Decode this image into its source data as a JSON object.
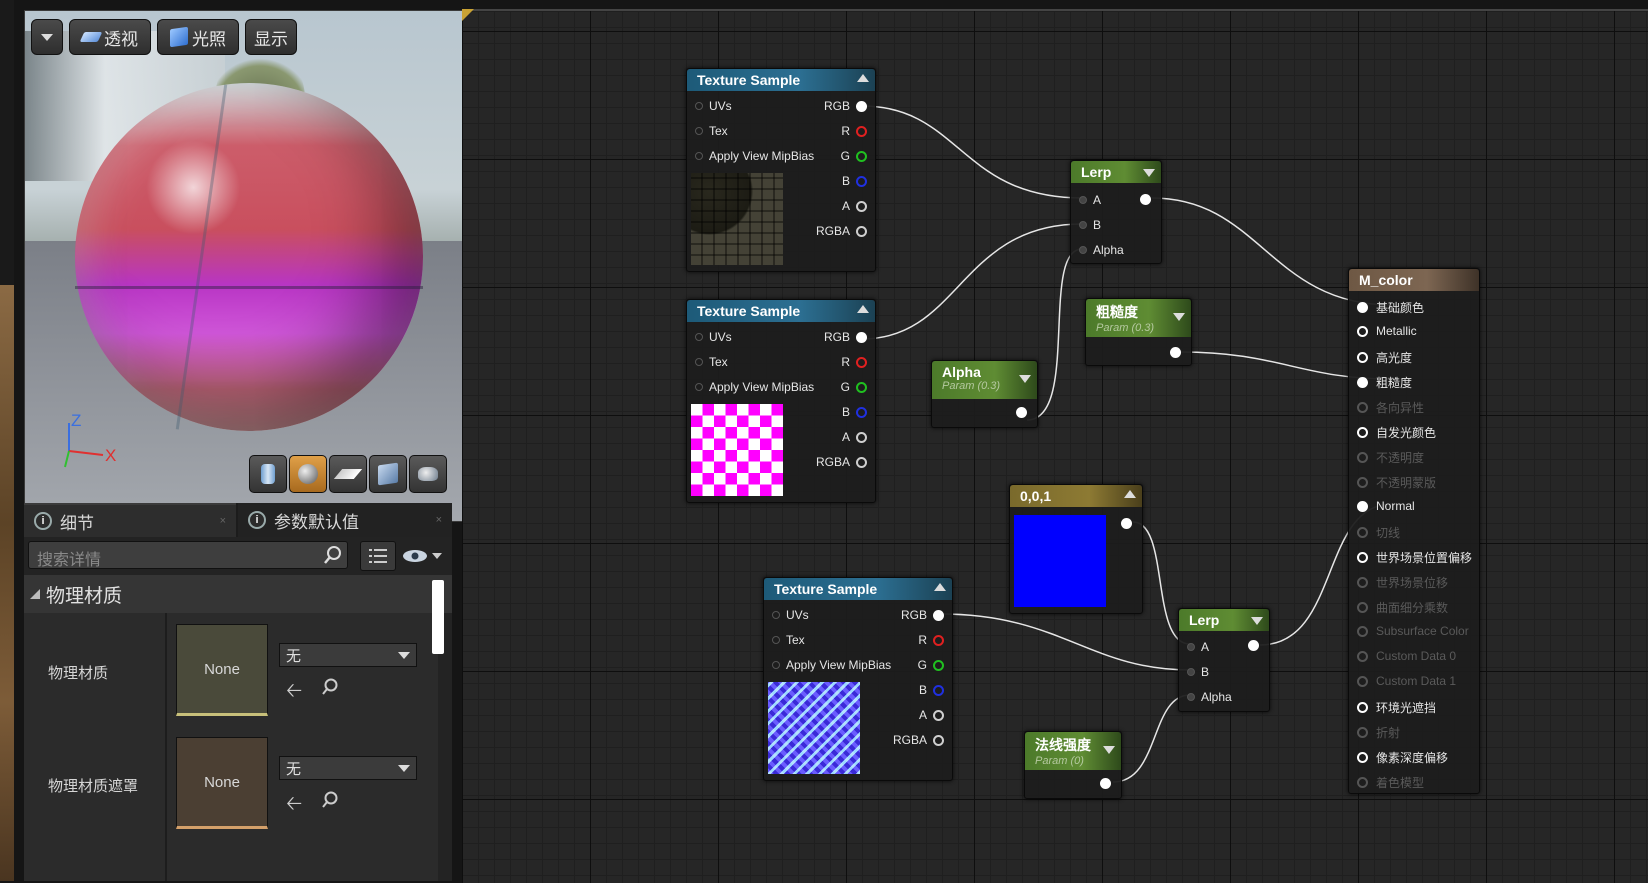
{
  "viewport": {
    "toolbar": {
      "perspective": "透视",
      "lit": "光照",
      "show": "显示"
    },
    "axis": {
      "z": "Z",
      "x": "X"
    }
  },
  "details": {
    "tabs": [
      {
        "label": "细节"
      },
      {
        "label": "参数默认值"
      }
    ],
    "search_placeholder": "搜索详情",
    "category": "物理材质",
    "rows": [
      {
        "label": "物理材质",
        "swatch": "None",
        "value": "无"
      },
      {
        "label": "物理材质遮罩",
        "swatch": "None",
        "value": "无"
      }
    ]
  },
  "graph": {
    "texture_pins_in": [
      "UVs",
      "Tex",
      "Apply View MipBias"
    ],
    "texture_pins_out": [
      "RGB",
      "R",
      "G",
      "B",
      "A",
      "RGBA"
    ],
    "tex1": {
      "title": "Texture Sample"
    },
    "tex2": {
      "title": "Texture Sample"
    },
    "tex3": {
      "title": "Texture Sample"
    },
    "lerp1": {
      "title": "Lerp",
      "pins": [
        "A",
        "B",
        "Alpha"
      ]
    },
    "lerp2": {
      "title": "Lerp",
      "pins": [
        "A",
        "B",
        "Alpha"
      ]
    },
    "rough": {
      "title": "粗糙度",
      "sub": "Param (0.3)"
    },
    "alpha": {
      "title": "Alpha",
      "sub": "Param (0.3)"
    },
    "normal_strength": {
      "title": "法线强度",
      "sub": "Param (0)"
    },
    "vec": {
      "title": "0,0,1",
      "color": "#0000ff"
    },
    "material": {
      "title": "M_color",
      "pins": [
        {
          "label": "基础颜色",
          "state": "on"
        },
        {
          "label": "Metallic",
          "state": "open"
        },
        {
          "label": "高光度",
          "state": "open"
        },
        {
          "label": "粗糙度",
          "state": "on"
        },
        {
          "label": "各向异性",
          "state": "off"
        },
        {
          "label": "自发光颜色",
          "state": "open"
        },
        {
          "label": "不透明度",
          "state": "off"
        },
        {
          "label": "不透明蒙版",
          "state": "off"
        },
        {
          "label": "Normal",
          "state": "on"
        },
        {
          "label": "切线",
          "state": "off"
        },
        {
          "label": "世界场景位置偏移",
          "state": "open"
        },
        {
          "label": "世界场景位移",
          "state": "off"
        },
        {
          "label": "曲面细分乘数",
          "state": "off"
        },
        {
          "label": "Subsurface Color",
          "state": "off"
        },
        {
          "label": "Custom Data 0",
          "state": "off"
        },
        {
          "label": "Custom Data 1",
          "state": "off"
        },
        {
          "label": "环境光遮挡",
          "state": "open"
        },
        {
          "label": "折射",
          "state": "off"
        },
        {
          "label": "像素深度偏移",
          "state": "open"
        },
        {
          "label": "着色模型",
          "state": "off"
        }
      ]
    }
  }
}
